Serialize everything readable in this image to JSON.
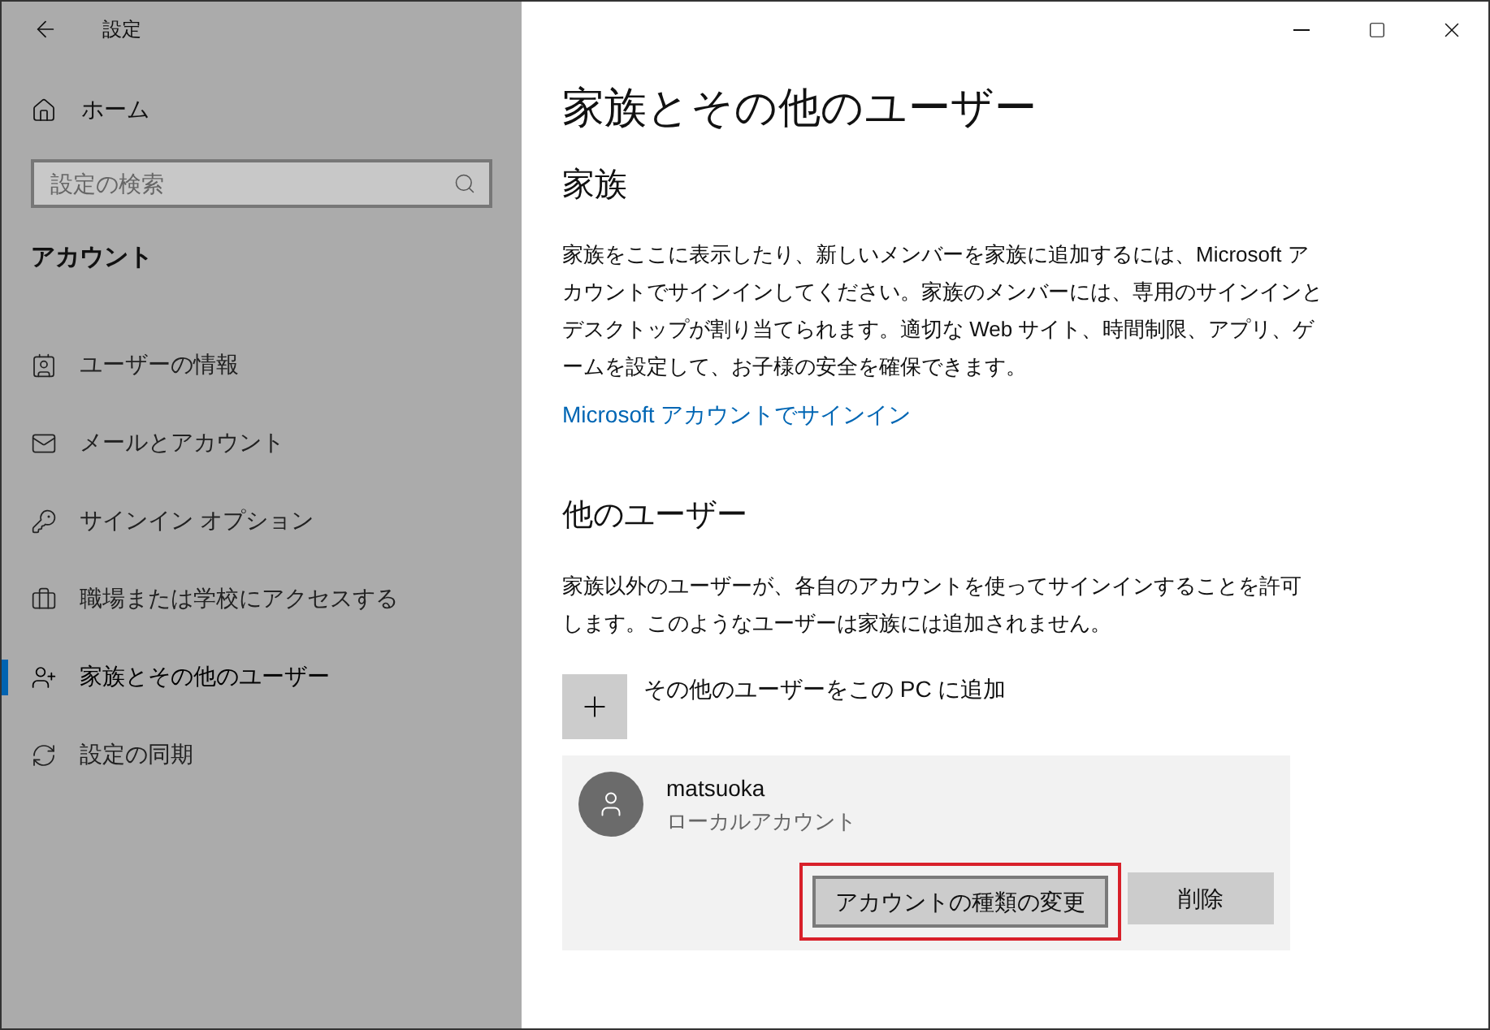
{
  "window": {
    "title": "設定"
  },
  "sidebar": {
    "home": "ホーム",
    "search": {
      "placeholder": "設定の検索"
    },
    "section": "アカウント",
    "items": [
      {
        "kind": "user-info",
        "label": "ユーザーの情報",
        "selected": false
      },
      {
        "kind": "mail",
        "label": "メールとアカウント",
        "selected": false
      },
      {
        "kind": "key",
        "label": "サインイン オプション",
        "selected": false
      },
      {
        "kind": "briefcase",
        "label": "職場または学校にアクセスする",
        "selected": false
      },
      {
        "kind": "user-add",
        "label": "家族とその他のユーザー",
        "selected": true
      },
      {
        "kind": "sync",
        "label": "設定の同期",
        "selected": false
      }
    ]
  },
  "page": {
    "title": "家族とその他のユーザー",
    "family": {
      "heading": "家族",
      "text": "家族をここに表示したり、新しいメンバーを家族に追加するには、Microsoft アカウントでサインインしてください。家族のメンバーには、専用のサインインとデスクトップが割り当てられます。適切な Web サイト、時間制限、アプリ、ゲームを設定して、お子様の安全を確保できます。",
      "link": "Microsoft アカウントでサインイン"
    },
    "others": {
      "heading": "他のユーザー",
      "text": "家族以外のユーザーが、各自のアカウントを使ってサインインすることを許可します。このようなユーザーは家族には追加されません。",
      "add": "その他のユーザーをこの PC に追加",
      "user": {
        "name": "matsuoka",
        "type": "ローカルアカウント",
        "buttons": [
          {
            "label": "アカウントの種類の変更",
            "highlighted": true
          },
          {
            "label": "削除",
            "highlighted": false
          }
        ]
      }
    }
  }
}
